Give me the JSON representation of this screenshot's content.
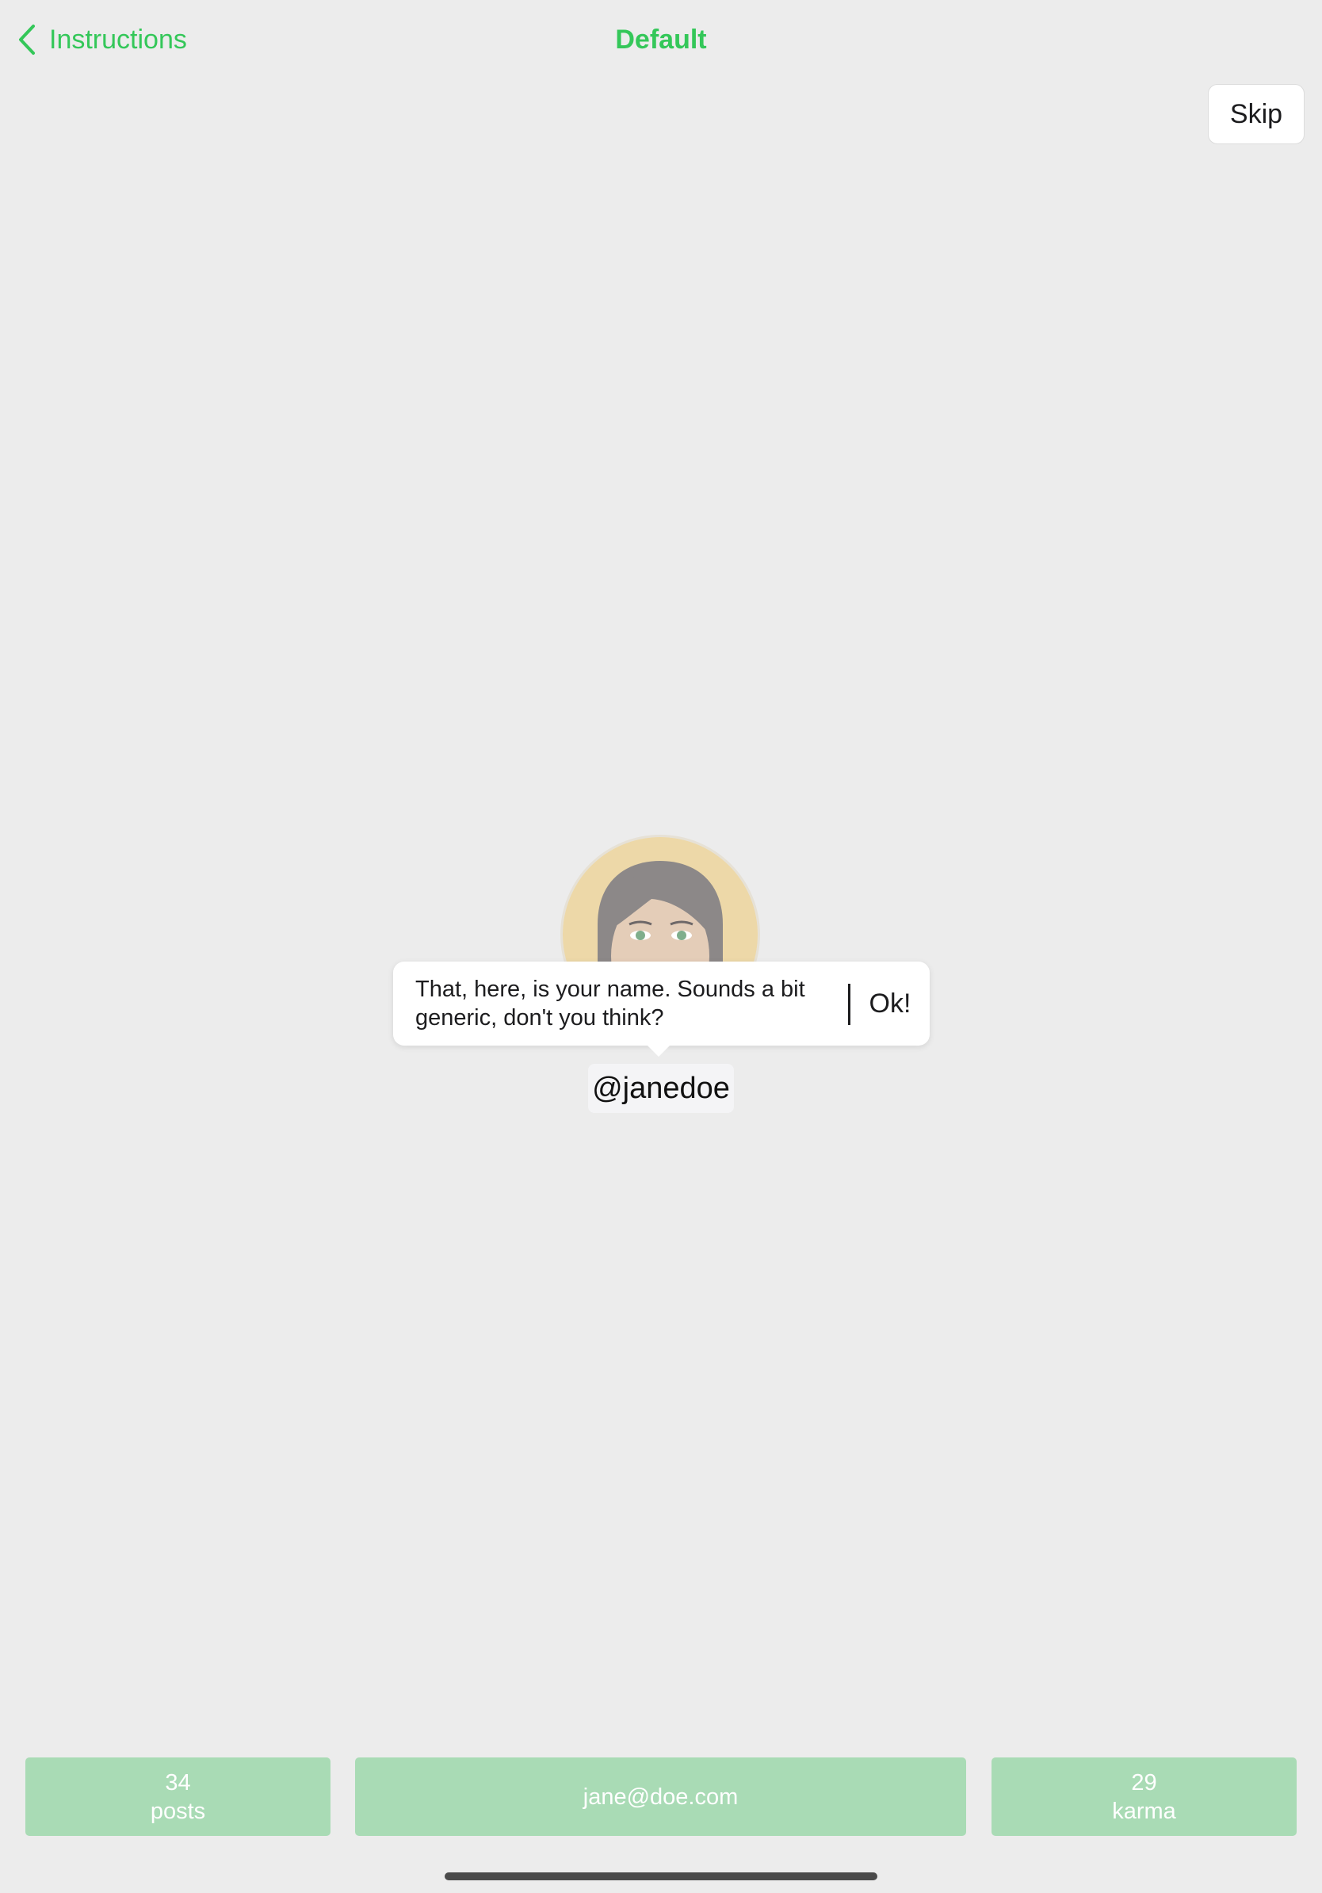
{
  "nav": {
    "back_label": "Instructions",
    "title": "Default"
  },
  "skip_label": "Skip",
  "tooltip": {
    "text": "That, here, is your name. Sounds a bit generic, don't you think?",
    "ok_label": "Ok!"
  },
  "profile": {
    "username": "@janedoe"
  },
  "stats": {
    "posts": {
      "value": "34",
      "label": "posts"
    },
    "email": "jane@doe.com",
    "karma": {
      "value": "29",
      "label": "karma"
    }
  },
  "colors": {
    "accent": "#34c759",
    "stat_card_bg": "#a9dbb5",
    "background": "#ececec"
  },
  "icons": {
    "back": "chevron-left-icon"
  }
}
